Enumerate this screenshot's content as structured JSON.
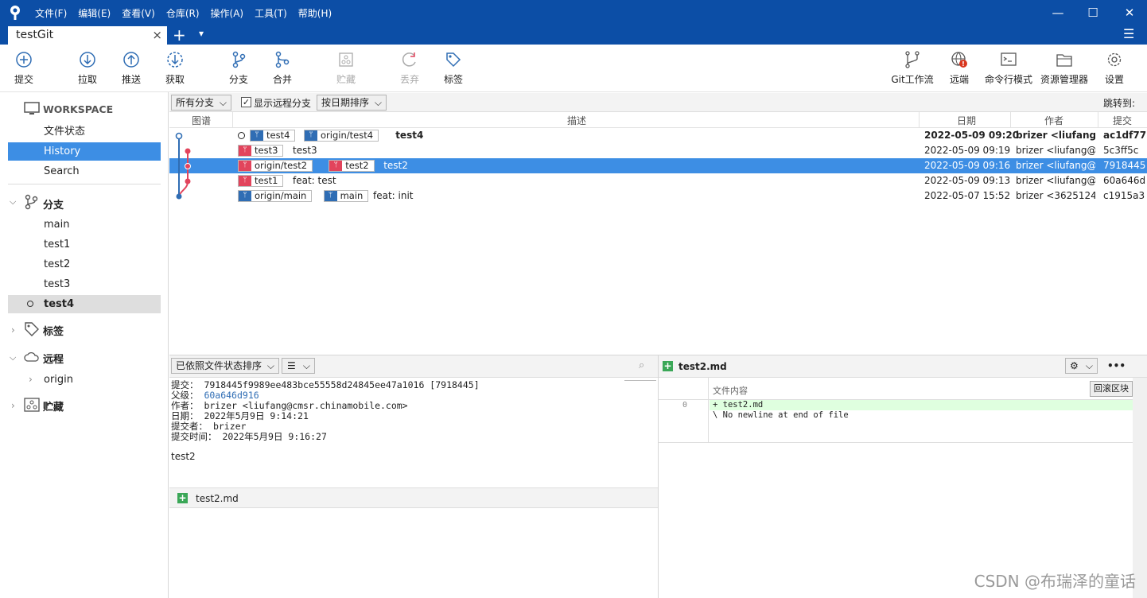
{
  "titlebar": {
    "menus": [
      "文件(F)",
      "编辑(E)",
      "查看(V)",
      "仓库(R)",
      "操作(A)",
      "工具(T)",
      "帮助(H)"
    ]
  },
  "tabbar": {
    "tab_label": "testGit",
    "close": "×",
    "new_tab": "+",
    "dropdown": "▾",
    "hamburger": "☰"
  },
  "toolbar": {
    "left": [
      "提交",
      "拉取",
      "推送",
      "获取",
      "分支",
      "合并",
      "贮藏",
      "丢弃",
      "标签"
    ],
    "right": [
      "Git工作流",
      "远端",
      "命令行模式",
      "资源管理器",
      "设置"
    ]
  },
  "sidebar": {
    "workspace": "WORKSPACE",
    "workspace_items": [
      "文件状态",
      "History",
      "Search"
    ],
    "branches_title": "分支",
    "branches": [
      "main",
      "test1",
      "test2",
      "test3",
      "test4"
    ],
    "tags_title": "标签",
    "remotes_title": "远程",
    "remotes": [
      "origin"
    ],
    "stash_title": "贮藏"
  },
  "filter": {
    "branch_select": "所有分支",
    "show_remote_label": "显示远程分支",
    "sort_select": "按日期排序",
    "jump_to": "跳转到:"
  },
  "columns": {
    "graph": "图谱",
    "desc": "描述",
    "date": "日期",
    "author": "作者",
    "commit": "提交"
  },
  "commits": [
    {
      "tags": [
        {
          "t": "test4",
          "c": "blue"
        },
        {
          "t": "origin/test4",
          "c": "blue"
        }
      ],
      "desc": "test4",
      "date": "2022-05-09 09:20",
      "author": "brizer <liufang@",
      "hash": "ac1df77",
      "bold": true
    },
    {
      "tags": [
        {
          "t": "test3",
          "c": "red"
        }
      ],
      "desc": "test3",
      "date": "2022-05-09 09:19",
      "author": "brizer <liufang@",
      "hash": "5c3ff5c"
    },
    {
      "tags": [
        {
          "t": "origin/test2",
          "c": "red"
        },
        {
          "t": "test2",
          "c": "red"
        }
      ],
      "desc": "test2",
      "date": "2022-05-09 09:16",
      "author": "brizer <liufang@",
      "hash": "7918445",
      "selected": true
    },
    {
      "tags": [
        {
          "t": "test1",
          "c": "red"
        }
      ],
      "desc": "feat: test",
      "date": "2022-05-09 09:13",
      "author": "brizer <liufang@",
      "hash": "60a646d"
    },
    {
      "tags": [
        {
          "t": "origin/main",
          "c": "blue"
        },
        {
          "t": "main",
          "c": "blue"
        }
      ],
      "desc": "feat: init",
      "date": "2022-05-07 15:52",
      "author": "brizer <3625124",
      "hash": "c1915a3"
    }
  ],
  "lower": {
    "sort_select": "已依照文件状态排序",
    "details": {
      "commit_label": "提交：",
      "commit_value": "7918445f9989ee483bce55558d24845ee47a1016 [7918445]",
      "parent_label": "父级：",
      "parent_value": "60a646d916",
      "author_label": "作者：",
      "author_value": "brizer <liufang@cmsr.chinamobile.com>",
      "date_label": "日期：",
      "date_value": "2022年5月9日 9:14:21",
      "committer_label": "提交者：",
      "committer_value": "brizer",
      "commit_time_label": "提交时间：",
      "commit_time_value": "2022年5月9日 9:16:27",
      "message": "test2"
    },
    "file": "test2.md"
  },
  "diff": {
    "file": "test2.md",
    "header": "文件内容",
    "revert_btn": "回滚区块",
    "line_no": "0",
    "line1": "+ test2.md",
    "line2": "\\  No newline at end of file",
    "more": "•••"
  },
  "watermark": "CSDN @布瑞泽的童话"
}
